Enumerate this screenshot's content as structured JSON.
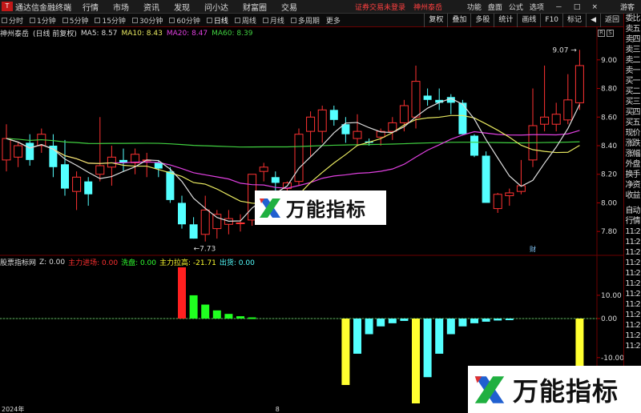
{
  "app": {
    "logo_text": "T",
    "title": "通达信金融终端",
    "menu": [
      "行情",
      "市场",
      "资讯",
      "发现",
      "问小达",
      "财富圈",
      "交易"
    ],
    "login_status": "证券交易未登录",
    "stock_link": "神州泰岳",
    "top_right": [
      "功能",
      "盘面",
      "公式",
      "选项"
    ],
    "window_buttons": [
      "－",
      "□",
      "×"
    ],
    "guest": "游客"
  },
  "periods": {
    "items": [
      "分时",
      "1分钟",
      "5分钟",
      "15分钟",
      "30分钟",
      "60分钟",
      "日线",
      "周线",
      "月线",
      "多周期",
      "更多"
    ],
    "active": "日线"
  },
  "tools": [
    "复权",
    "叠加",
    "多股",
    "统计",
    "画线",
    "F10",
    "标记",
    "◀",
    "返回"
  ],
  "main_header": {
    "stock": "神州泰岳",
    "period_note": "(日线 前复权)",
    "ma5": "MA5: 8.57",
    "ma10": "MA10: 8.43",
    "ma20": "MA20: 8.47",
    "ma60": "MA60: 8.39"
  },
  "sub_header": {
    "name": "股票指标网",
    "z": "Z: 0.00",
    "l1": "主力进场: 0.00",
    "l2": "洗盘: 0.00",
    "l3": "主力拉高: -21.71",
    "l4": "出货: 0.00"
  },
  "right_tags": [
    "R",
    "S"
  ],
  "sidebar": {
    "top": [
      "委比",
      "卖五",
      "卖四",
      "卖三",
      "卖二",
      "卖一",
      "买一",
      "买二",
      "买三",
      "买四",
      "买五",
      "现价",
      "涨跌",
      "涨幅",
      "外盘",
      "换手",
      "净资",
      "收益"
    ],
    "bottom": [
      "自动",
      "行情",
      "11:2",
      "11:2",
      "11:2",
      "11:2",
      "11:2",
      "11:2",
      "11:2",
      "11:2",
      "11:2",
      "11:2",
      "11:2",
      "11:2"
    ]
  },
  "axes": {
    "price_ticks": [
      "9.00",
      "8.80",
      "8.60",
      "8.40",
      "8.20",
      "8.00",
      "7.80"
    ],
    "indicator_ticks": [
      "10.00",
      "0.00",
      "-10.00"
    ],
    "x_labels": [
      "2024年",
      "8"
    ],
    "high_label": "9.07",
    "low_label": "7.73",
    "cai_label": "财"
  },
  "watermark": {
    "text": "万能指标"
  },
  "colors": {
    "up": "#ff3232",
    "down": "#54ffff",
    "ma5": "#dddddd",
    "ma10": "#e8e860",
    "ma20": "#e040e0",
    "ma60": "#40d040",
    "bg": "#000000"
  },
  "chart_data": {
    "type": "candlestick",
    "price_range": [
      7.65,
      9.15
    ],
    "candles": [
      {
        "o": 8.3,
        "h": 8.55,
        "l": 8.22,
        "c": 8.45
      },
      {
        "o": 8.32,
        "h": 8.42,
        "l": 8.25,
        "c": 8.4
      },
      {
        "o": 8.42,
        "h": 8.48,
        "l": 8.26,
        "c": 8.3
      },
      {
        "o": 8.4,
        "h": 8.52,
        "l": 8.35,
        "c": 8.48
      },
      {
        "o": 8.4,
        "h": 8.48,
        "l": 8.18,
        "c": 8.25
      },
      {
        "o": 8.27,
        "h": 8.44,
        "l": 8.05,
        "c": 8.1
      },
      {
        "o": 8.08,
        "h": 8.22,
        "l": 7.95,
        "c": 8.18
      },
      {
        "o": 8.15,
        "h": 8.18,
        "l": 7.98,
        "c": 8.06
      },
      {
        "o": 8.2,
        "h": 8.6,
        "l": 8.15,
        "c": 8.26
      },
      {
        "o": 8.25,
        "h": 8.4,
        "l": 8.12,
        "c": 8.32
      },
      {
        "o": 8.3,
        "h": 8.38,
        "l": 8.22,
        "c": 8.28
      },
      {
        "o": 8.28,
        "h": 8.38,
        "l": 8.2,
        "c": 8.34
      },
      {
        "o": 8.3,
        "h": 8.35,
        "l": 8.18,
        "c": 8.3
      },
      {
        "o": 8.28,
        "h": 8.3,
        "l": 8.18,
        "c": 8.24
      },
      {
        "o": 8.22,
        "h": 8.25,
        "l": 8.0,
        "c": 8.02
      },
      {
        "o": 8.0,
        "h": 8.05,
        "l": 7.82,
        "c": 7.85
      },
      {
        "o": 7.85,
        "h": 7.9,
        "l": 7.75,
        "c": 7.75
      },
      {
        "o": 7.78,
        "h": 8.05,
        "l": 7.73,
        "c": 7.95
      },
      {
        "o": 7.82,
        "h": 7.95,
        "l": 7.75,
        "c": 7.92
      },
      {
        "o": 7.85,
        "h": 7.95,
        "l": 7.78,
        "c": 7.89
      },
      {
        "o": 7.86,
        "h": 7.92,
        "l": 7.8,
        "c": 7.86
      },
      {
        "o": 7.88,
        "h": 8.2,
        "l": 7.84,
        "c": 8.2
      },
      {
        "o": 8.22,
        "h": 8.28,
        "l": 8.15,
        "c": 8.25
      },
      {
        "o": 8.18,
        "h": 8.22,
        "l": 8.08,
        "c": 8.14
      },
      {
        "o": 8.1,
        "h": 8.15,
        "l": 8.06,
        "c": 8.14
      },
      {
        "o": 8.15,
        "h": 8.52,
        "l": 8.12,
        "c": 8.48
      },
      {
        "o": 8.5,
        "h": 8.64,
        "l": 8.32,
        "c": 8.6
      },
      {
        "o": 8.5,
        "h": 8.68,
        "l": 8.42,
        "c": 8.65
      },
      {
        "o": 8.65,
        "h": 8.68,
        "l": 8.54,
        "c": 8.58
      },
      {
        "o": 8.55,
        "h": 8.6,
        "l": 8.42,
        "c": 8.48
      },
      {
        "o": 8.45,
        "h": 8.62,
        "l": 8.4,
        "c": 8.5
      },
      {
        "o": 8.43,
        "h": 8.45,
        "l": 8.4,
        "c": 8.42
      },
      {
        "o": 8.46,
        "h": 8.52,
        "l": 8.4,
        "c": 8.5
      },
      {
        "o": 8.5,
        "h": 8.6,
        "l": 8.44,
        "c": 8.56
      },
      {
        "o": 8.56,
        "h": 8.72,
        "l": 8.5,
        "c": 8.68
      },
      {
        "o": 8.6,
        "h": 8.96,
        "l": 8.52,
        "c": 8.85
      },
      {
        "o": 8.75,
        "h": 8.8,
        "l": 8.68,
        "c": 8.72
      },
      {
        "o": 8.72,
        "h": 8.8,
        "l": 8.65,
        "c": 8.7
      },
      {
        "o": 8.74,
        "h": 8.76,
        "l": 8.62,
        "c": 8.7
      },
      {
        "o": 8.7,
        "h": 8.72,
        "l": 8.48,
        "c": 8.48
      },
      {
        "o": 8.47,
        "h": 8.48,
        "l": 8.32,
        "c": 8.33
      },
      {
        "o": 8.33,
        "h": 8.36,
        "l": 8.0,
        "c": 8.0
      },
      {
        "o": 7.96,
        "h": 8.07,
        "l": 7.93,
        "c": 8.06
      },
      {
        "o": 8.05,
        "h": 8.1,
        "l": 7.98,
        "c": 8.07
      },
      {
        "o": 8.08,
        "h": 8.3,
        "l": 8.06,
        "c": 8.12
      },
      {
        "o": 8.3,
        "h": 8.8,
        "l": 8.25,
        "c": 8.54
      },
      {
        "o": 8.55,
        "h": 8.96,
        "l": 8.5,
        "c": 8.6
      },
      {
        "o": 8.55,
        "h": 8.7,
        "l": 8.5,
        "c": 8.62
      },
      {
        "o": 8.58,
        "h": 8.9,
        "l": 8.55,
        "c": 8.72
      },
      {
        "o": 8.7,
        "h": 9.07,
        "l": 8.65,
        "c": 8.96
      }
    ],
    "indicator_range": [
      -21.71,
      22
    ],
    "indicator": [
      {
        "i": 15,
        "v": 22,
        "type": "red"
      },
      {
        "i": 16,
        "v": 10,
        "type": "green"
      },
      {
        "i": 17,
        "v": 6,
        "type": "green"
      },
      {
        "i": 18,
        "v": 3.5,
        "type": "green"
      },
      {
        "i": 19,
        "v": 2,
        "type": "green"
      },
      {
        "i": 20,
        "v": 1,
        "type": "green"
      },
      {
        "i": 21,
        "v": 0.5,
        "type": "green"
      },
      {
        "i": 29,
        "v": -17,
        "type": "yellow"
      },
      {
        "i": 30,
        "v": -9,
        "type": "cyan"
      },
      {
        "i": 31,
        "v": -4,
        "type": "cyan"
      },
      {
        "i": 32,
        "v": -2,
        "type": "cyan"
      },
      {
        "i": 33,
        "v": -1.2,
        "type": "cyan"
      },
      {
        "i": 34,
        "v": -0.6,
        "type": "cyan"
      },
      {
        "i": 35,
        "v": -21.71,
        "type": "yellow"
      },
      {
        "i": 36,
        "v": -15,
        "type": "cyan"
      },
      {
        "i": 37,
        "v": -9,
        "type": "cyan"
      },
      {
        "i": 38,
        "v": -4,
        "type": "cyan"
      },
      {
        "i": 39,
        "v": -2,
        "type": "cyan"
      },
      {
        "i": 40,
        "v": -1.2,
        "type": "cyan"
      },
      {
        "i": 41,
        "v": -0.8,
        "type": "cyan"
      },
      {
        "i": 42,
        "v": -0.5,
        "type": "cyan"
      },
      {
        "i": 43,
        "v": -0.3,
        "type": "cyan"
      },
      {
        "i": 49,
        "v": -17,
        "type": "yellow"
      }
    ]
  }
}
